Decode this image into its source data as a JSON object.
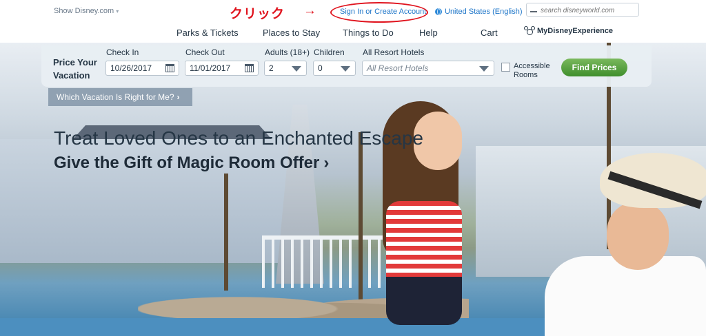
{
  "header": {
    "show_disney": "Show Disney.com",
    "show_disney_icon": "chevron-down-icon",
    "annotation_text": "クリック",
    "annotation_arrow": "→",
    "sign_in": "Sign In or Create Account",
    "locale": "United States (English)",
    "locale_icon": "globe-icon",
    "search_placeholder": "search disneyworld.com",
    "search_icon": "search-icon"
  },
  "nav": {
    "items": [
      {
        "label": "Parks & Tickets"
      },
      {
        "label": "Places to Stay"
      },
      {
        "label": "Things to Do"
      },
      {
        "label": "Help"
      },
      {
        "label": "Cart"
      }
    ],
    "my_disney_experience": "MyDisneyExperience"
  },
  "booking": {
    "title": "Price Your Vacation",
    "check_in_label": "Check In",
    "check_in_value": "10/26/2017",
    "check_out_label": "Check Out",
    "check_out_value": "11/01/2017",
    "adults_label": "Adults (18+)",
    "adults_value": "2",
    "children_label": "Children",
    "children_value": "0",
    "hotels_label": "All Resort Hotels",
    "hotels_value": "All Resort Hotels",
    "accessible_label": "Accessible Rooms",
    "accessible_checked": false,
    "find_button": "Find Prices"
  },
  "promo": {
    "which_vacation": "Which Vacation Is Right for Me?",
    "headline": "Treat Loved Ones to an Enchanted Escape",
    "subheadline": "Give the Gift of Magic Room Offer",
    "chevron": "›"
  },
  "colors": {
    "annotation_red": "#e0141e",
    "link_blue": "#1b74c8",
    "nav_text": "#253645",
    "find_button_green": "#4a9a35"
  }
}
